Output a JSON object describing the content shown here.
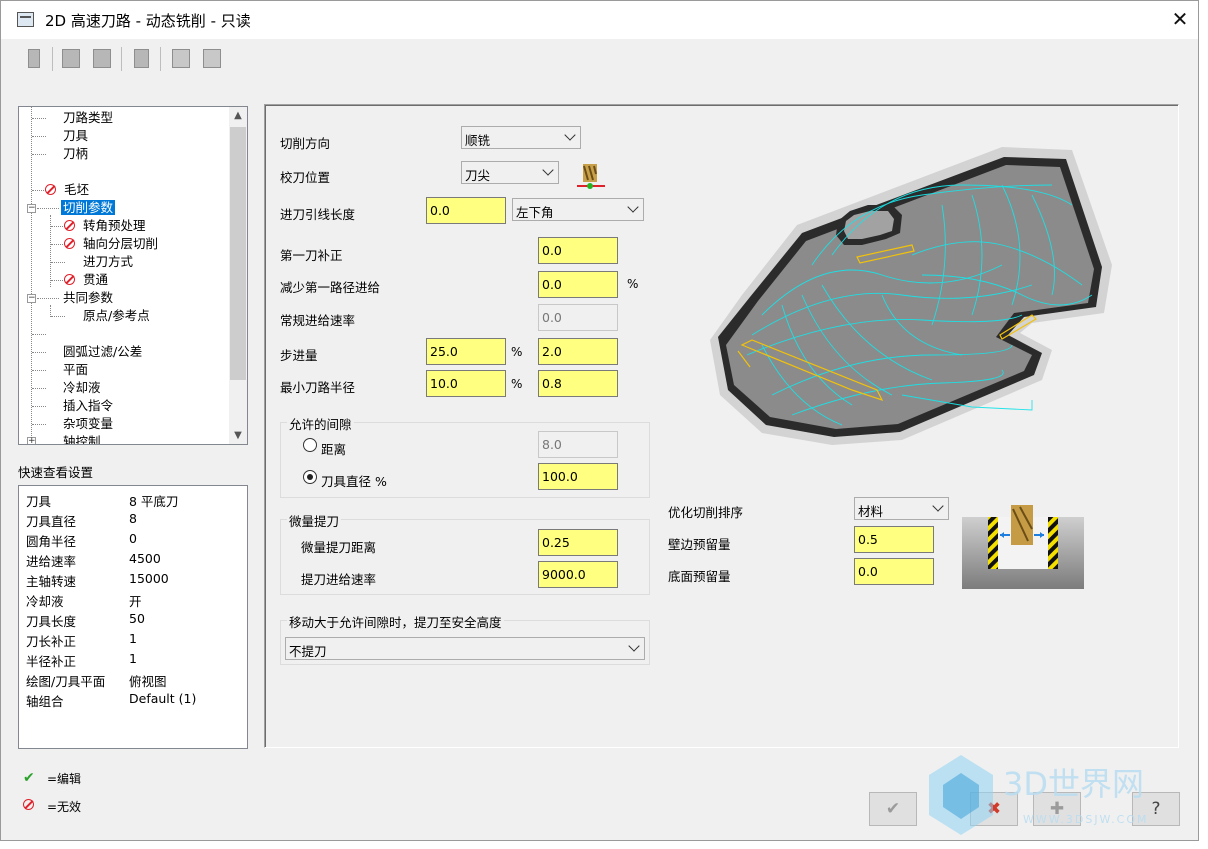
{
  "window": {
    "title": "2D 高速刀路 - 动态铣削 - 只读",
    "close_glyph": "✕"
  },
  "tree": {
    "items": [
      {
        "label": "刀路类型",
        "status": "none"
      },
      {
        "label": "刀具",
        "status": "none"
      },
      {
        "label": "刀柄",
        "status": "none"
      },
      {
        "label": "毛坯",
        "status": "disabled"
      },
      {
        "label": "切削参数",
        "status": "none",
        "selected": true
      },
      {
        "label": "转角预处理",
        "status": "disabled"
      },
      {
        "label": "轴向分层切削",
        "status": "disabled"
      },
      {
        "label": "进刀方式",
        "status": "none"
      },
      {
        "label": "贯通",
        "status": "disabled"
      },
      {
        "label": "共同参数",
        "status": "none"
      },
      {
        "label": "原点/参考点",
        "status": "none"
      },
      {
        "label": "圆弧过滤/公差",
        "status": "none"
      },
      {
        "label": "平面",
        "status": "none"
      },
      {
        "label": "冷却液",
        "status": "none"
      },
      {
        "label": "插入指令",
        "status": "none"
      },
      {
        "label": "杂项变量",
        "status": "none"
      },
      {
        "label": "轴控制",
        "status": "none"
      }
    ]
  },
  "quick_view": {
    "title": "快速查看设置",
    "rows": [
      {
        "key": "刀具",
        "value": "8 平底刀"
      },
      {
        "key": "刀具直径",
        "value": "8"
      },
      {
        "key": "圆角半径",
        "value": "0"
      },
      {
        "key": "进给速率",
        "value": "4500"
      },
      {
        "key": "主轴转速",
        "value": "15000"
      },
      {
        "key": "冷却液",
        "value": "开"
      },
      {
        "key": "刀具长度",
        "value": "50"
      },
      {
        "key": "刀长补正",
        "value": "1"
      },
      {
        "key": "半径补正",
        "value": "1"
      },
      {
        "key": "绘图/刀具平面",
        "value": "俯视图"
      },
      {
        "key": "轴组合",
        "value": "Default (1)"
      }
    ]
  },
  "legend": {
    "edited": "=编辑",
    "invalid": "=无效"
  },
  "params": {
    "cut_direction": {
      "label": "切削方向",
      "value": "顺铣"
    },
    "tool_position": {
      "label": "校刀位置",
      "value": "刀尖"
    },
    "lead_in_length": {
      "label": "进刀引线长度",
      "value": "0.0",
      "corner": "左下角"
    },
    "first_pass_offset": {
      "label": "第一刀补正",
      "value": "0.0"
    },
    "reduce_first_feed": {
      "label": "减少第一路径进给",
      "value": "0.0",
      "unit": "%"
    },
    "normal_feed": {
      "label": "常规进给速率",
      "value": "0.0"
    },
    "stepover": {
      "label": "步进量",
      "percent": "25.0",
      "unit": "%",
      "value": "2.0"
    },
    "min_radius": {
      "label": "最小刀路半径",
      "percent": "10.0",
      "unit": "%",
      "value": "0.8"
    }
  },
  "gap": {
    "title": "允许的间隙",
    "distance_label": "距离",
    "distance_value": "8.0",
    "diameter_label": "刀具直径 %",
    "diameter_value": "100.0"
  },
  "micro_lift": {
    "title": "微量提刀",
    "distance_label": "微量提刀距离",
    "distance_value": "0.25",
    "feed_label": "提刀进给速率",
    "feed_value": "9000.0"
  },
  "retract": {
    "title": "移动大于允许间隙时，提刀至安全高度",
    "value": "不提刀"
  },
  "optimize": {
    "label": "优化切削排序",
    "value": "材料",
    "wall_label": "壁边预留量",
    "wall_value": "0.5",
    "floor_label": "底面预留量",
    "floor_value": "0.0"
  },
  "buttons": {
    "ok": "✔",
    "cancel": "✖",
    "add": "✚",
    "help": "?"
  },
  "watermark": {
    "text": "3D世界网",
    "url": "WWW.3DSJW.COM"
  },
  "colors": {
    "toolpath": "#19e3e8",
    "field_bg": "#ffff80",
    "selected": "#0078d7",
    "invalid": "#e0202a"
  }
}
